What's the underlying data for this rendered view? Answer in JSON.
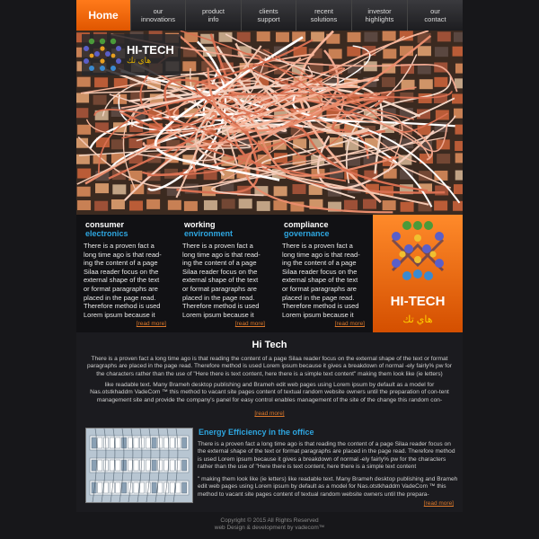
{
  "nav": {
    "home": "Home",
    "items": [
      {
        "line1": "our",
        "line2": "innovations"
      },
      {
        "line1": "product",
        "line2": "info"
      },
      {
        "line1": "clients",
        "line2": "support"
      },
      {
        "line1": "recent",
        "line2": "solutions"
      },
      {
        "line1": "investor",
        "line2": "highlights"
      },
      {
        "line1": "our",
        "line2": "contact"
      }
    ]
  },
  "brand": {
    "name": "HI-TECH",
    "arabic": "هاي تك"
  },
  "features": [
    {
      "title1": "consumer",
      "title2": "electronics",
      "body": "There is a proven fact a long time ago is that read-ing the content of a page Silaa reader focus on the external shape of the text or format paragraphs are placed in the page read. Therefore method is used Lorem ipsum because it",
      "more": "[read more]"
    },
    {
      "title1": "working",
      "title2": "environment",
      "body": "There is a proven fact a long time ago is that read-ing the content of a page Silaa reader focus on the external shape of the text or format paragraphs are placed in the page read. Therefore method is used Lorem ipsum because it",
      "more": "[read more]"
    },
    {
      "title1": "compliance",
      "title2": "governance",
      "body": "There is a proven fact a long time ago is that read-ing the content of a page Silaa reader focus on the external shape of the text or format paragraphs are placed in the page read. Therefore method is used Lorem ipsum because it",
      "more": "[read more]"
    }
  ],
  "about": {
    "title": "Hi Tech",
    "para1": "There is a proven fact a long time ago is that reading the content of a page Silaa reader focus on the external shape of the text or format paragraphs are placed in the page read. Therefore method is used Lorem ipsum because it gives a breakdown of normal -ely fairly% pw for the characters rather than the use of \"Here there is text content, here there is a simple text content\" making them look like (ie letters)",
    "para2": "like readable text. Many Brameh desktop publishing and Brameh edit web pages using Lorem ipsum by default as a model for Nas.otstkhaddm VadeCom ™ this method to vacant site pages content of textual random website owners until the preparation of con-tent management site and provide the company's panel for easy control enables management of the site of the change this random con-",
    "more": "[read more]"
  },
  "energy": {
    "title": "Energy Efficiency in the  office",
    "para1": "There is a proven fact a long time ago is that reading the content of a page Silaa reader focus on the external shape of the text or format paragraphs are placed in the page read. Therefore method is used Lorem ipsum because it gives a breakdown of normal -ely fairly% pw for the characters rather than the use of \"Here there is text content, here there is a simple text content",
    "para2": "\" making them look like (ie letters) like readable text. Many Brameh desktop publishing and Brameh edit web pages using Lorem ipsum by default as a model for Nas.otstkhaddm VadeCom ™ this method to vacant site pages content of textual random website owners until the prepara-",
    "more": "[read more]"
  },
  "footer": {
    "copyright": "Copyright © 2015 All Rights Reserved",
    "credit": "web Design & development by vadecom™"
  },
  "colors": {
    "accent": "#ff7a1a",
    "link": "#2ea6e0",
    "readmore": "#e07a2a",
    "background": "#17171a"
  }
}
